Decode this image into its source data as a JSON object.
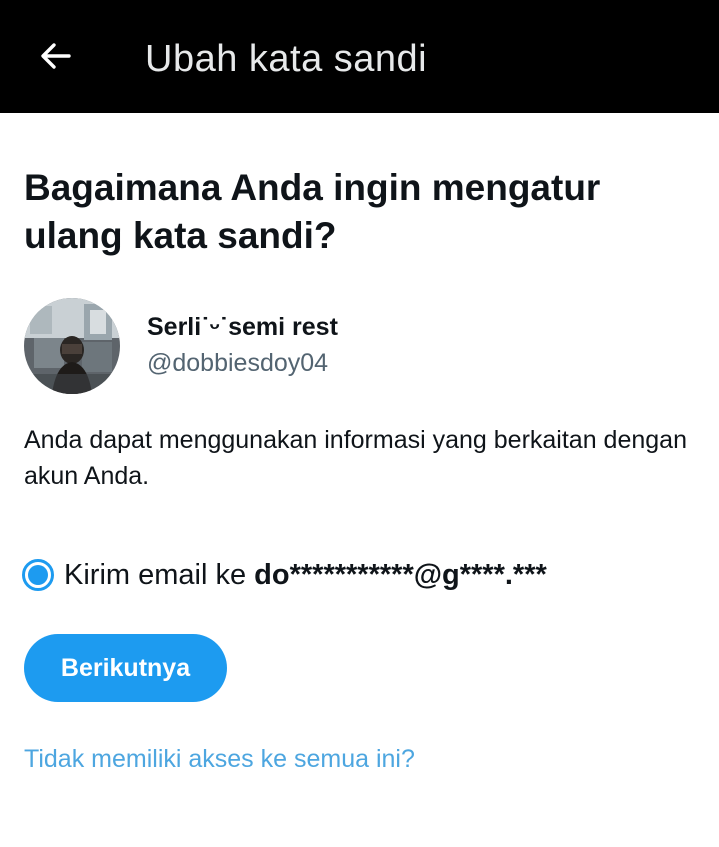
{
  "header": {
    "title": "Ubah kata sandi",
    "back_icon": "arrow-left-icon"
  },
  "main": {
    "heading": "Bagaimana Anda ingin mengatur ulang kata sandi?",
    "account": {
      "avatar_icon": "user-avatar",
      "display_name": "Serli˙ᵕ˙semi rest",
      "handle": "@dobbiesdoy04"
    },
    "info_text": "Anda dapat menggunakan informasi yang berkaitan dengan akun Anda.",
    "option": {
      "label_prefix": "Kirim email ke",
      "masked_email": "do***********@g****.***",
      "selected": true
    },
    "next_button_label": "Berikutnya",
    "no_access_link": "Tidak memiliki akses ke semua ini?"
  },
  "colors": {
    "accent": "#1d9bf0",
    "link": "#4da6e0",
    "header_bg": "#000000",
    "header_text": "#e7e9ea",
    "secondary_text": "#536471"
  }
}
